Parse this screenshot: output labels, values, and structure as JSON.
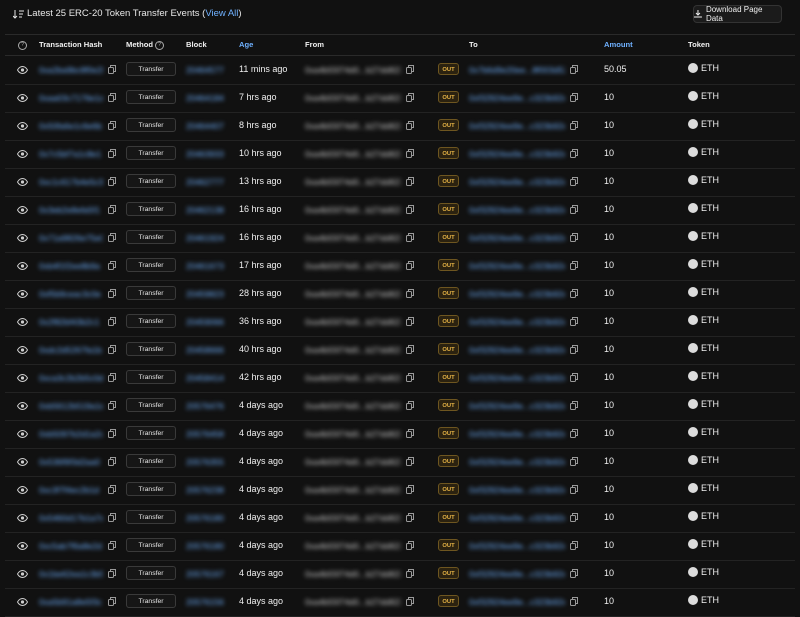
{
  "header": {
    "title_prefix": "Latest 25 ERC-20 Token Transfer Events (",
    "view_all": "View All",
    "title_suffix": ")",
    "download_label": "Download Page Data"
  },
  "columns": {
    "help": "?",
    "hash": "Transaction Hash",
    "method": "Method",
    "block": "Block",
    "age": "Age",
    "from": "From",
    "to": "To",
    "amount": "Amount",
    "token": "Token"
  },
  "colors": {
    "link": "#6fb1ff",
    "out_badge": "#e9b647",
    "background": "#111111"
  },
  "rows": [
    {
      "hash": "0xa2ba9bc8f0e2ba",
      "method": "Transfer",
      "block": "20464577",
      "age": "11 mins ago",
      "from": "0xa4b55f74d0...b27dd823f0",
      "direction": "OUT",
      "to": "0x7b6d9e20ee...8f003d52f0",
      "amount": "50.05",
      "token": "ETH"
    },
    {
      "hash": "0xaa03c7176e1a",
      "method": "Transfer",
      "block": "20464184",
      "age": "7 hrs ago",
      "from": "0xa4b55f74d0...b27dd823f0",
      "direction": "OUT",
      "to": "0xf32924ee9e...c323b92e1f",
      "amount": "10",
      "token": "ETH"
    },
    {
      "hash": "0x50fa6e1c6e6b",
      "method": "Transfer",
      "block": "20464407",
      "age": "8 hrs ago",
      "from": "0xa4b55f74d0...b27dd823f0",
      "direction": "OUT",
      "to": "0xf32924ee9e...c323b92e1f",
      "amount": "10",
      "token": "ETH"
    },
    {
      "hash": "0x7c5bf7a1c8e1",
      "method": "Transfer",
      "block": "20463933",
      "age": "10 hrs ago",
      "from": "0xa4b55f74d0...b27dd823f0",
      "direction": "OUT",
      "to": "0xf32924ee9e...c323b92e1f",
      "amount": "10",
      "token": "ETH"
    },
    {
      "hash": "0xc1c617b4e5c3",
      "method": "Transfer",
      "block": "20462777",
      "age": "13 hrs ago",
      "from": "0xa4b55f74d0...b27dd823f0",
      "direction": "OUT",
      "to": "0xf32924ee9e...c323b92e1f",
      "amount": "10",
      "token": "ETH"
    },
    {
      "hash": "0x3eb2e8efa5f1",
      "method": "Transfer",
      "block": "20462138",
      "age": "16 hrs ago",
      "from": "0xa4b55f74d0...b27dd823f0",
      "direction": "OUT",
      "to": "0xf32924ee9e...c323b92e1f",
      "amount": "10",
      "token": "ETH"
    },
    {
      "hash": "0x71a9826e75e0",
      "method": "Transfer",
      "block": "20461924",
      "age": "16 hrs ago",
      "from": "0xa4b55f74d0...b27dd823f0",
      "direction": "OUT",
      "to": "0xf32924ee9e...c323b92e1f",
      "amount": "10",
      "token": "ETH"
    },
    {
      "hash": "0xb4f1f2ee8b9a",
      "method": "Transfer",
      "block": "20461673",
      "age": "17 hrs ago",
      "from": "0xa4b55f74d0...b27dd823f0",
      "direction": "OUT",
      "to": "0xf32924ee9e...c323b92e1f",
      "amount": "10",
      "token": "ETH"
    },
    {
      "hash": "0xf5b9ceac3c0e",
      "method": "Transfer",
      "block": "20459823",
      "age": "28 hrs ago",
      "from": "0xa4b55f74d0...b27dd823f0",
      "direction": "OUT",
      "to": "0xf32924ee9e...c323b92e1f",
      "amount": "10",
      "token": "ETH"
    },
    {
      "hash": "0x2f82bf43b2c1",
      "method": "Transfer",
      "block": "20459066",
      "age": "36 hrs ago",
      "from": "0xa4b55f74d0...b27dd823f0",
      "direction": "OUT",
      "to": "0xf32924ee9e...c323b92e1f",
      "amount": "10",
      "token": "ETH"
    },
    {
      "hash": "0xdc2d5267fa1b",
      "method": "Transfer",
      "block": "20458666",
      "age": "40 hrs ago",
      "from": "0xa4b55f74d0...b27dd823f0",
      "direction": "OUT",
      "to": "0xf32924ee9e...c323b92e1f",
      "amount": "10",
      "token": "ETH"
    },
    {
      "hash": "0xca3c2b2b5c0d",
      "method": "Transfer",
      "block": "20458414",
      "age": "42 hrs ago",
      "from": "0xa4b55f74d0...b27dd823f0",
      "direction": "OUT",
      "to": "0xf32924ee9e...c323b92e1f",
      "amount": "10",
      "token": "ETH"
    },
    {
      "hash": "0xb5612b519a1e",
      "method": "Transfer",
      "block": "20576476",
      "age": "4 days ago",
      "from": "0xa4b55f74d0...b27dd823f0",
      "direction": "OUT",
      "to": "0xf32924ee9e...c323b92e1f",
      "amount": "10",
      "token": "ETH"
    },
    {
      "hash": "0xb5097b2d1a2c",
      "method": "Transfer",
      "block": "20576458",
      "age": "4 days ago",
      "from": "0xa4b55f74d0...b27dd823f0",
      "direction": "OUT",
      "to": "0xf32924ee9e...c323b92e1f",
      "amount": "10",
      "token": "ETH"
    },
    {
      "hash": "0x536f9f3d2aa0",
      "method": "Transfer",
      "block": "20576355",
      "age": "4 days ago",
      "from": "0xa4b55f74d0...b27dd823f0",
      "direction": "OUT",
      "to": "0xf32924ee9e...c323b92e1f",
      "amount": "10",
      "token": "ETH"
    },
    {
      "hash": "0xc3f7f4ec2b1d",
      "method": "Transfer",
      "block": "20576238",
      "age": "4 days ago",
      "from": "0xa4b55f74d0...b27dd823f0",
      "direction": "OUT",
      "to": "0xf32924ee9e...c323b92e1f",
      "amount": "10",
      "token": "ETH"
    },
    {
      "hash": "0x5460d17b1a7e",
      "method": "Transfer",
      "block": "20576180",
      "age": "4 days ago",
      "from": "0xa4b55f74d0...b27dd823f0",
      "direction": "OUT",
      "to": "0xf32924ee9e...c323b92e1f",
      "amount": "10",
      "token": "ETH"
    },
    {
      "hash": "0xc5ab7f6a8e2d",
      "method": "Transfer",
      "block": "20576180",
      "age": "4 days ago",
      "from": "0xa4b55f74d0...b27dd823f0",
      "direction": "OUT",
      "to": "0xf32924ee9e...c323b92e1f",
      "amount": "10",
      "token": "ETH"
    },
    {
      "hash": "0x1be62ea1c3b5",
      "method": "Transfer",
      "block": "20576167",
      "age": "4 days ago",
      "from": "0xa4b55f74d0...b27dd823f0",
      "direction": "OUT",
      "to": "0xf32924ee9e...c323b92e1f",
      "amount": "10",
      "token": "ETH"
    },
    {
      "hash": "0xa5b91a8e5f3c",
      "method": "Transfer",
      "block": "20576156",
      "age": "4 days ago",
      "from": "0xa4b55f74d0...b27dd823f0",
      "direction": "OUT",
      "to": "0xf32924ee9e...c323b92e1f",
      "amount": "10",
      "token": "ETH"
    }
  ]
}
